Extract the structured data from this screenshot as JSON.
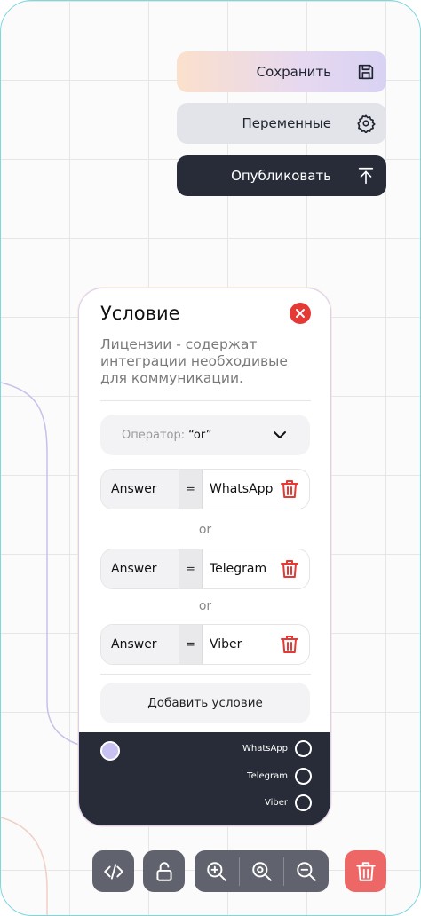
{
  "toolbar": {
    "save_label": "Сохранить",
    "variables_label": "Переменные",
    "publish_label": "Опубликовать"
  },
  "card": {
    "title": "Условие",
    "description": "Лицензии - содержат интеграции необходивые для коммуникации.",
    "operator_key": "Оператор:",
    "operator_value": "“or”",
    "conditions": [
      {
        "field": "Answer",
        "op": "=",
        "value": "WhatsApp"
      },
      {
        "field": "Answer",
        "op": "=",
        "value": "Telegram"
      },
      {
        "field": "Answer",
        "op": "=",
        "value": "Viber"
      }
    ],
    "joiner": "or",
    "add_label": "Добавить условие",
    "outputs": [
      "WhatsApp",
      "Telegram",
      "Viber"
    ]
  },
  "colors": {
    "accent_dark": "#272c38",
    "delete_red": "#e53935",
    "port_lilac": "#c8c2f2",
    "frame_border": "#7fd6df"
  },
  "icons": [
    "save-icon",
    "gear-icon",
    "upload-icon",
    "close-icon",
    "chevron-down-icon",
    "trash-icon",
    "code-icon",
    "lock-icon",
    "zoom-in-icon",
    "zoom-fit-icon",
    "zoom-out-icon"
  ]
}
